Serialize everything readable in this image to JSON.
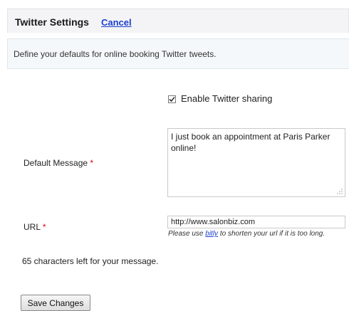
{
  "header": {
    "title": "Twitter Settings",
    "cancel_label": "Cancel"
  },
  "description": "Define your defaults for online booking Twitter tweets.",
  "enable_sharing": {
    "label": "Enable Twitter sharing",
    "checked": true
  },
  "default_message": {
    "label": "Default Message",
    "required_mark": "*",
    "value": "I just book an appointment at Paris Parker online!"
  },
  "url": {
    "label": "URL",
    "required_mark": "*",
    "value": "http://www.salonbiz.com",
    "hint_before": "Please use ",
    "hint_link": "bitly",
    "hint_after": " to shorten your url if it is too long."
  },
  "chars_left": "65 characters left for your message.",
  "save_button_label": "Save Changes",
  "colors": {
    "link": "#1c3fcf",
    "required": "#dd0000",
    "header_bg": "#f4f4f6",
    "description_bg": "#f4f8fa"
  }
}
